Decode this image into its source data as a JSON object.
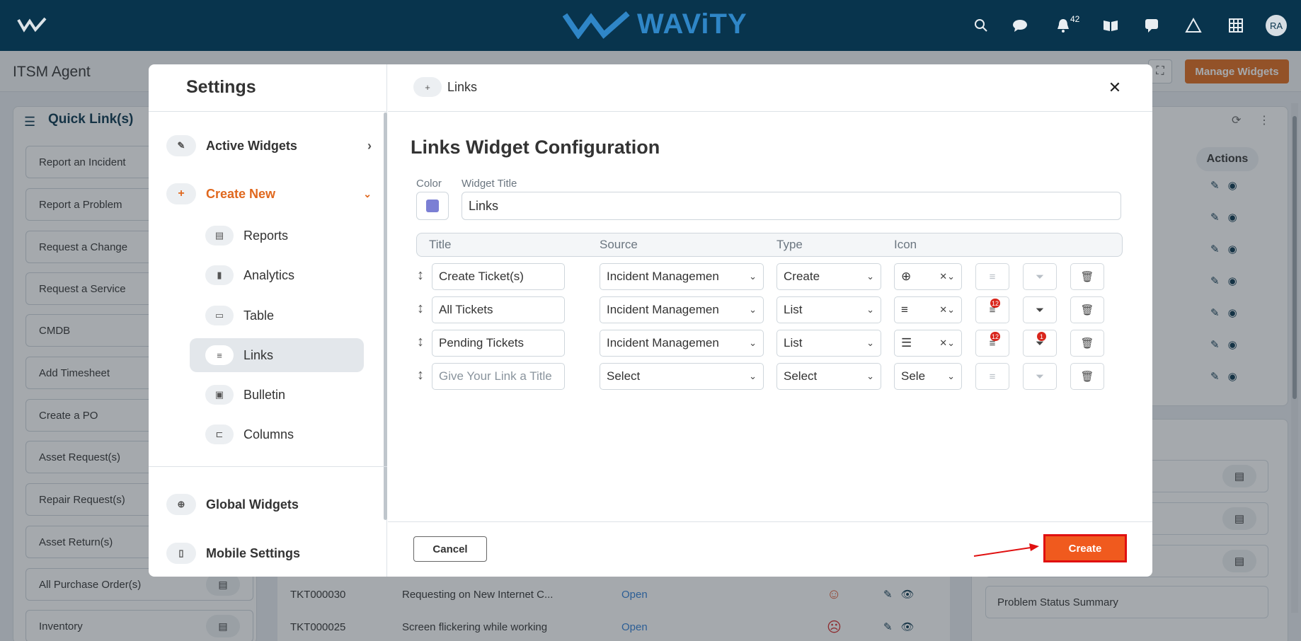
{
  "header": {
    "brand_text": "WAViTY",
    "notifications_count": "42",
    "avatar_initials": "RA"
  },
  "page": {
    "title": "ITSM Agent",
    "manage_widgets_label": "Manage Widgets"
  },
  "quick_links": {
    "title": "Quick Link(s)",
    "items": [
      {
        "label": "Report an Incident"
      },
      {
        "label": "Report a Problem"
      },
      {
        "label": "Request a Change"
      },
      {
        "label": "Request a Service"
      },
      {
        "label": "CMDB"
      },
      {
        "label": "Add Timesheet"
      },
      {
        "label": "Create a PO"
      },
      {
        "label": "Asset Request(s)"
      },
      {
        "label": "Repair Request(s)"
      },
      {
        "label": "Asset Return(s)"
      },
      {
        "label": "All Purchase Order(s)"
      },
      {
        "label": "Inventory"
      }
    ]
  },
  "tickets": [
    {
      "id": "TKT000030",
      "subject": "Requesting on New Internet C...",
      "status": "Open"
    },
    {
      "id": "TKT000025",
      "subject": "Screen flickering while working",
      "status": "Open"
    }
  ],
  "right_panel": {
    "actions_header": "Actions",
    "summary_item": "Problem Status Summary"
  },
  "modal": {
    "sidebar_title": "Settings",
    "active_widgets": "Active Widgets",
    "create_new": "Create New",
    "sub_items": {
      "reports": "Reports",
      "analytics": "Analytics",
      "table": "Table",
      "links": "Links",
      "bulletin": "Bulletin",
      "columns": "Columns"
    },
    "global_widgets": "Global Widgets",
    "mobile_settings": "Mobile Settings",
    "tab_label": "Links",
    "config_title": "Links Widget Configuration",
    "color_label": "Color",
    "color_value": "#7b7fd4",
    "widget_title_label": "Widget Title",
    "widget_title_value": "Links",
    "columns": {
      "title": "Title",
      "source": "Source",
      "type": "Type",
      "icon": "Icon"
    },
    "rows": [
      {
        "title": "Create Ticket(s)",
        "source": "Incident Managemen",
        "type": "Create",
        "icon": "plus-circle-icon",
        "list_badge": "",
        "filter_badge": ""
      },
      {
        "title": "All Tickets",
        "source": "Incident Managemen",
        "type": "List",
        "icon": "lines-icon",
        "list_badge": "12",
        "filter_badge": ""
      },
      {
        "title": "Pending Tickets",
        "source": "Incident Managemen",
        "type": "List",
        "icon": "sort-lines-icon",
        "list_badge": "12",
        "filter_badge": "1"
      },
      {
        "title_placeholder": "Give Your Link a Title",
        "source": "Select",
        "type": "Select",
        "icon_text": "Sele"
      }
    ],
    "cancel_label": "Cancel",
    "create_label": "Create"
  }
}
